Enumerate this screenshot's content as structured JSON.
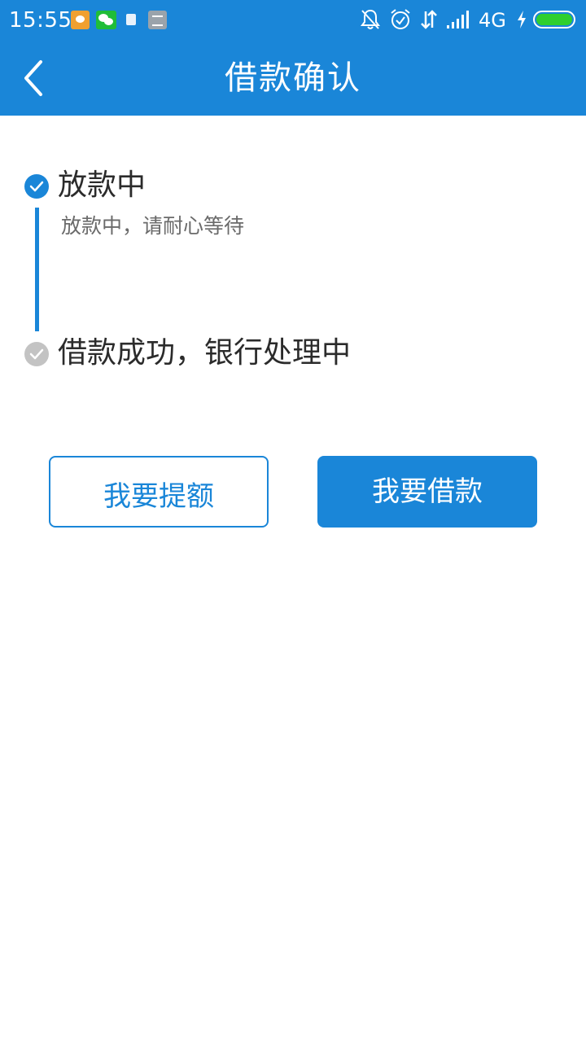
{
  "status_bar": {
    "time": "15:55",
    "network": "4G",
    "battery_level": 1.0,
    "icons": [
      "chat-bubble-icon",
      "wechat-icon",
      "document-icon",
      "list-app-icon",
      "bell-muted-icon",
      "alarm-icon",
      "data-transfer-icon",
      "signal-icon",
      "charging-icon",
      "battery-icon"
    ]
  },
  "header": {
    "title": "借款确认",
    "back_icon": "chevron-left-icon"
  },
  "steps": [
    {
      "title": "放款中",
      "description": "放款中，请耐心等待",
      "state": "active"
    },
    {
      "title": "借款成功，银行处理中",
      "state": "pending"
    }
  ],
  "actions": {
    "raise_limit_label": "我要提额",
    "borrow_label": "我要借款"
  },
  "colors": {
    "primary": "#1a86d8",
    "inactive_dot": "#c3c3c3",
    "battery_fill": "#2fcf2f",
    "text_dark": "#2b2b2b",
    "text_muted": "#6a6a6a"
  }
}
